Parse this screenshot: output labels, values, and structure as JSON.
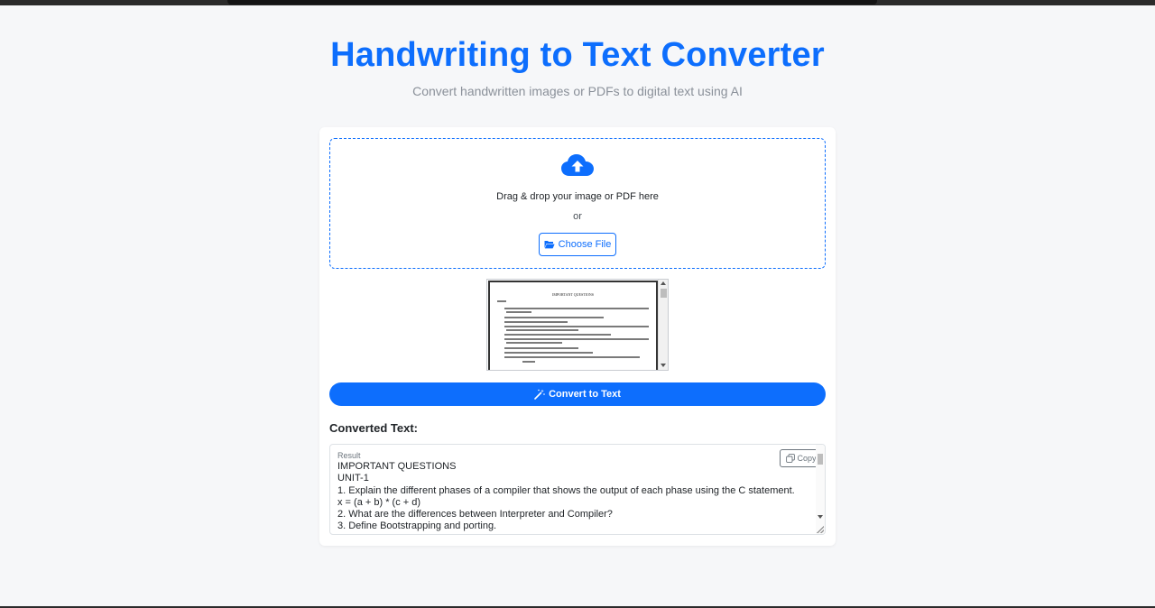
{
  "header": {
    "title": "Handwriting to Text Converter",
    "subtitle": "Convert handwritten images or PDFs to digital text using AI"
  },
  "upload": {
    "icon": "cloud-upload-icon",
    "drop_text": "Drag & drop your image or PDF here",
    "or_text": "or",
    "choose_label": "Choose File",
    "choose_icon": "folder-open-icon"
  },
  "preview": {
    "title": "IMPORTANT QUESTIONS"
  },
  "convert": {
    "label": "Convert to Text",
    "icon": "magic-wand-icon"
  },
  "result": {
    "heading": "Converted Text:",
    "caption": "Result",
    "copy_label": "Copy",
    "copy_icon": "copy-icon",
    "lines": [
      "IMPORTANT QUESTIONS",
      "UNIT-1",
      "1. Explain the different phases of a compiler that shows the output of each phase using the C statement.",
      "x = (a + b) * (c + d)",
      "2. What are the differences between Interpreter and Compiler?",
      "3. Define Bootstrapping and porting."
    ]
  },
  "colors": {
    "accent": "#0d6efd",
    "background": "#f6f7f9"
  }
}
